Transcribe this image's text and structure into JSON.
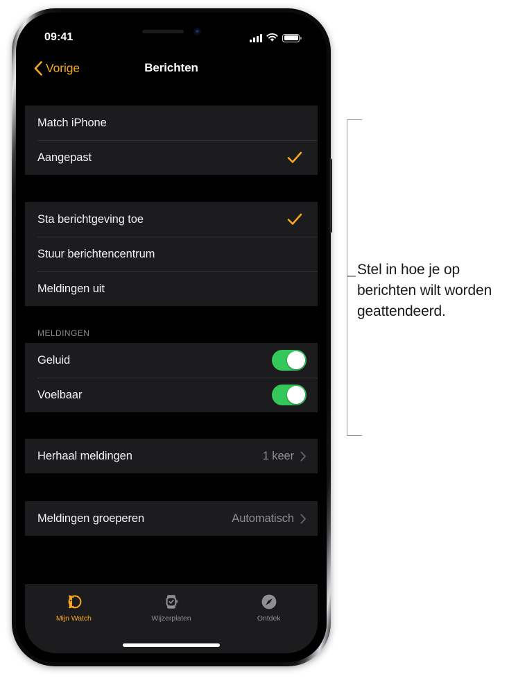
{
  "status_bar": {
    "time": "09:41",
    "signal_icon": "cellular-signal-icon",
    "wifi_icon": "wifi-icon",
    "battery_icon": "battery-icon"
  },
  "nav_bar": {
    "back_label": "Vorige",
    "title": "Berichten"
  },
  "sections": [
    {
      "header": "",
      "rows": [
        {
          "label": "Match iPhone",
          "type": "option",
          "checked": false
        },
        {
          "label": "Aangepast",
          "type": "option",
          "checked": true
        }
      ]
    },
    {
      "header": "",
      "rows": [
        {
          "label": "Sta berichtgeving toe",
          "type": "option",
          "checked": true
        },
        {
          "label": "Stuur berichtencentrum",
          "type": "option",
          "checked": false
        },
        {
          "label": "Meldingen uit",
          "type": "option",
          "checked": false
        }
      ]
    },
    {
      "header": "MELDINGEN",
      "rows": [
        {
          "label": "Geluid",
          "type": "toggle",
          "on": true
        },
        {
          "label": "Voelbaar",
          "type": "toggle",
          "on": true
        }
      ]
    },
    {
      "header": "",
      "rows": [
        {
          "label": "Herhaal meldingen",
          "type": "disclosure",
          "value": "1 keer"
        }
      ]
    },
    {
      "header": "",
      "rows": [
        {
          "label": "Meldingen groeperen",
          "type": "disclosure",
          "value": "Automatisch"
        }
      ]
    }
  ],
  "tab_bar": {
    "tabs": [
      {
        "label": "Mijn Watch",
        "icon": "watch-band-icon",
        "active": true
      },
      {
        "label": "Wijzerplaten",
        "icon": "watch-face-icon",
        "active": false
      },
      {
        "label": "Ontdek",
        "icon": "compass-icon",
        "active": false
      }
    ]
  },
  "callout": {
    "text": "Stel in hoe je op berichten wilt worden geattendeerd."
  },
  "colors": {
    "accent": "#f5a623",
    "toggle_on": "#34c759",
    "row_background": "#1c1c1e",
    "screen_background": "#000000",
    "separator": "#303032",
    "secondary_text": "#8e8e93"
  }
}
